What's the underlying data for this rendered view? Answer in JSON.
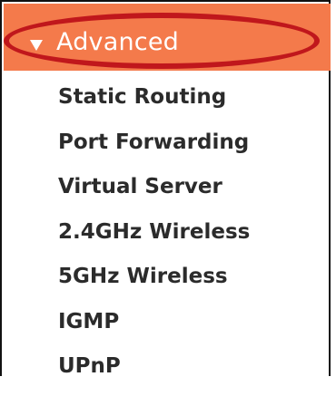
{
  "header": {
    "label": "Advanced",
    "expanded": true,
    "arrow_icon": "triangle-down-icon",
    "background_color": "#f47a4b",
    "text_color": "#ffffff"
  },
  "annotation": {
    "shape": "ellipse",
    "color": "#c0171c"
  },
  "menu": {
    "items": [
      {
        "label": "Static Routing"
      },
      {
        "label": "Port Forwarding"
      },
      {
        "label": "Virtual Server"
      },
      {
        "label": "2.4GHz Wireless"
      },
      {
        "label": "5GHz Wireless"
      },
      {
        "label": "IGMP"
      },
      {
        "label": "UPnP"
      }
    ]
  }
}
